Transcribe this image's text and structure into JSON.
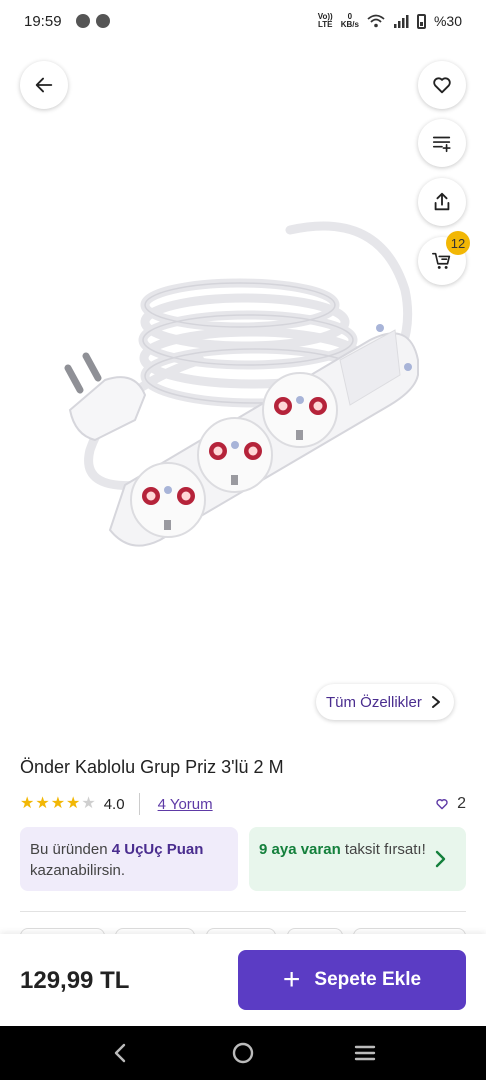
{
  "status_bar": {
    "time": "19:59",
    "network_top": "Vo))",
    "network_bottom": "LTE",
    "speed_top": "0",
    "speed_bottom": "KB/s",
    "battery": "%30"
  },
  "header": {
    "back_icon": "arrow-left-icon",
    "favorite_icon": "heart-icon",
    "list_icon": "add-to-list-icon",
    "share_icon": "share-icon",
    "cart_icon": "cart-icon",
    "cart_count": "12"
  },
  "specs_chip": {
    "label": "Tüm Özellikler"
  },
  "product": {
    "title": "Önder Kablolu Grup Priz 3'lü 2 M",
    "rating": "4.0",
    "rating_fraction": 0.8,
    "reviews": "4 Yorum",
    "likes": "2"
  },
  "promo": {
    "points_prefix": "Bu üründen ",
    "points_bold": "4 UçUç Puan",
    "points_suffix": "kazanabilirsin.",
    "install_bold": "9 aya varan",
    "install_text": " taksit fırsatı!"
  },
  "purchase": {
    "price": "129,99 TL",
    "add_button": "Sepete Ekle"
  },
  "colors": {
    "accent": "#5b3cc4",
    "star": "#f2b705",
    "badge": "#f2b705",
    "green": "#14803c"
  }
}
